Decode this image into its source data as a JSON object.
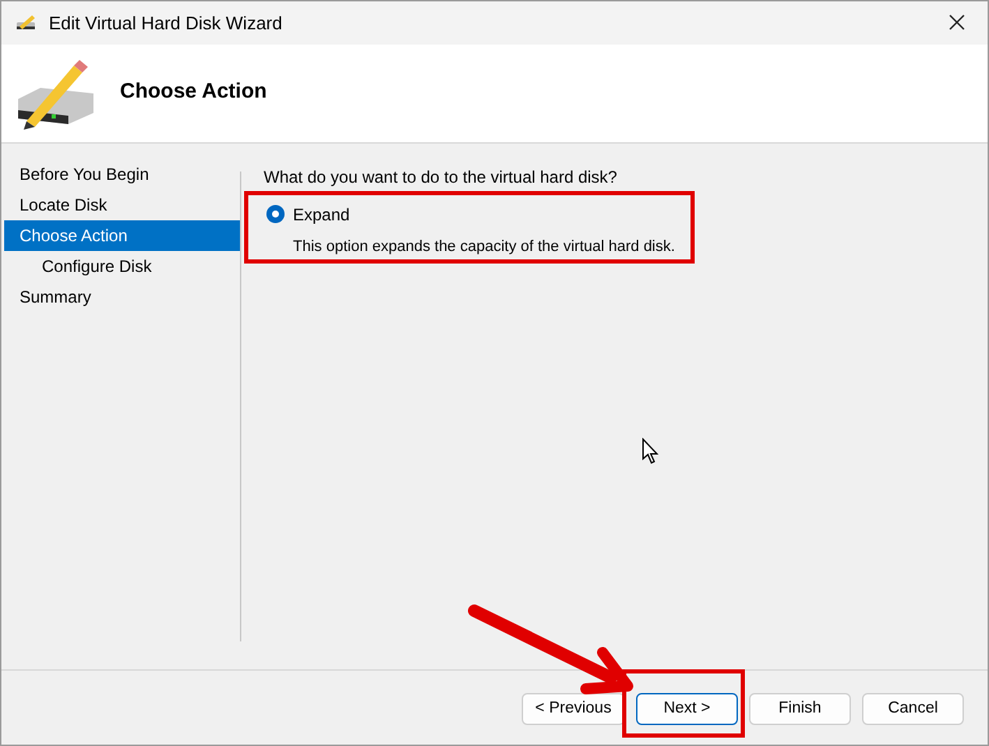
{
  "window": {
    "title": "Edit Virtual Hard Disk Wizard"
  },
  "header": {
    "title": "Choose Action"
  },
  "steps": [
    {
      "label": "Before You Begin",
      "selected": false
    },
    {
      "label": "Locate Disk",
      "selected": false
    },
    {
      "label": "Choose Action",
      "selected": true,
      "children": [
        {
          "label": "Configure Disk",
          "selected": false
        }
      ]
    },
    {
      "label": "Summary",
      "selected": false
    }
  ],
  "question": "What do you want to do to the virtual hard disk?",
  "options": [
    {
      "label": "Expand",
      "description": "This option expands the capacity of the virtual hard disk.",
      "selected": true
    }
  ],
  "buttons": [
    {
      "label": "< Previous",
      "default": false
    },
    {
      "label": "Next >",
      "default": true
    },
    {
      "label": "Finish",
      "default": false
    },
    {
      "label": "Cancel",
      "default": false
    }
  ]
}
